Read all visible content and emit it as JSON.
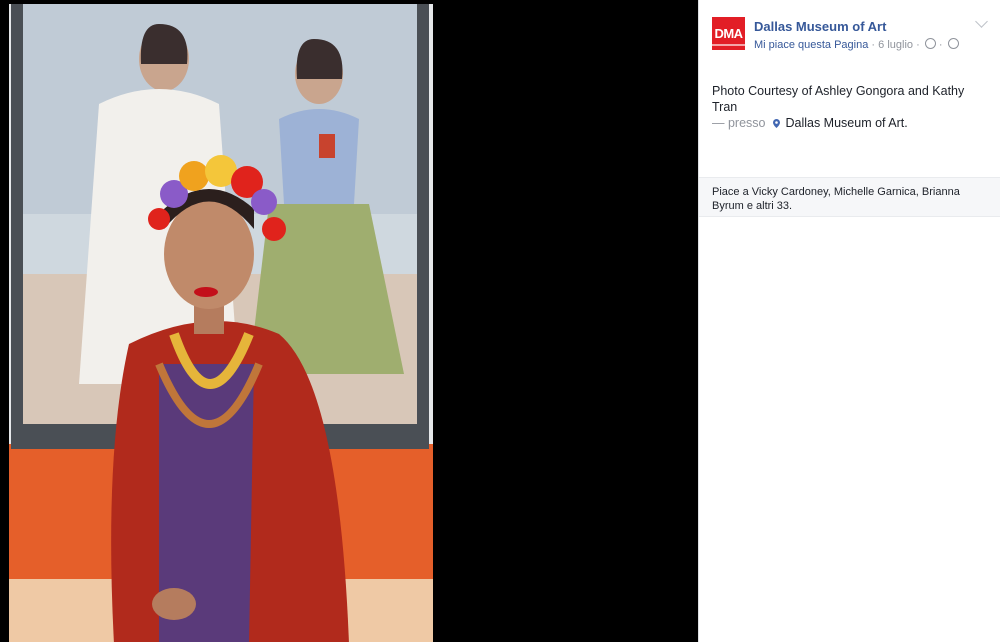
{
  "post": {
    "page_name": "Dallas Museum of Art",
    "logo_text": "DMA",
    "like_page": "Mi piace questa Pagina",
    "date": "6 luglio",
    "caption": "Photo Courtesy of Ashley Gongora and Kathy Tran",
    "location_prefix": "— presso",
    "location": "Dallas Museum of Art."
  },
  "likes": {
    "text": "Piace a Vicky Cardoney, Michelle Garnica, Brianna Byrum e altri 33."
  },
  "colors": {
    "brand_red": "#e21e26",
    "link_blue": "#365899",
    "wall_orange": "#e7602b"
  },
  "icons": [
    "clock-icon",
    "globe-icon",
    "location-pin-icon",
    "chevron-down-icon"
  ]
}
